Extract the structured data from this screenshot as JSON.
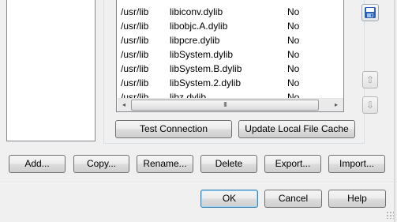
{
  "libraries": {
    "rows": [
      {
        "path": "/usr/lib",
        "name": "libiconv.dylib",
        "flag": "No"
      },
      {
        "path": "/usr/lib",
        "name": "libobjc.A.dylib",
        "flag": "No"
      },
      {
        "path": "/usr/lib",
        "name": "libpcre.dylib",
        "flag": "No"
      },
      {
        "path": "/usr/lib",
        "name": "libSystem.dylib",
        "flag": "No"
      },
      {
        "path": "/usr/lib",
        "name": "libSystem.B.dylib",
        "flag": "No"
      },
      {
        "path": "/usr/lib",
        "name": "libSystem.2.dylib",
        "flag": "No"
      },
      {
        "path": "/usr/lib",
        "name": "libz.dylib",
        "flag": "No"
      }
    ],
    "scroll_left": "◂",
    "scroll_right": "▸",
    "scroll_grip": "III"
  },
  "side_buttons": {
    "move_up": "⇧",
    "move_down": "⇩"
  },
  "connection_buttons": {
    "test_connection": "Test Connection",
    "update_cache": "Update Local File Cache"
  },
  "toolbar": {
    "add": "Add...",
    "copy": "Copy...",
    "rename": "Rename...",
    "delete": "Delete",
    "export": "Export...",
    "import": "Import..."
  },
  "dialog": {
    "ok": "OK",
    "cancel": "Cancel",
    "help": "Help"
  },
  "colors": {
    "window_bg": "#f0f0f0",
    "default_border": "#3c7fb1",
    "disk_blue": "#2b5fb3"
  }
}
